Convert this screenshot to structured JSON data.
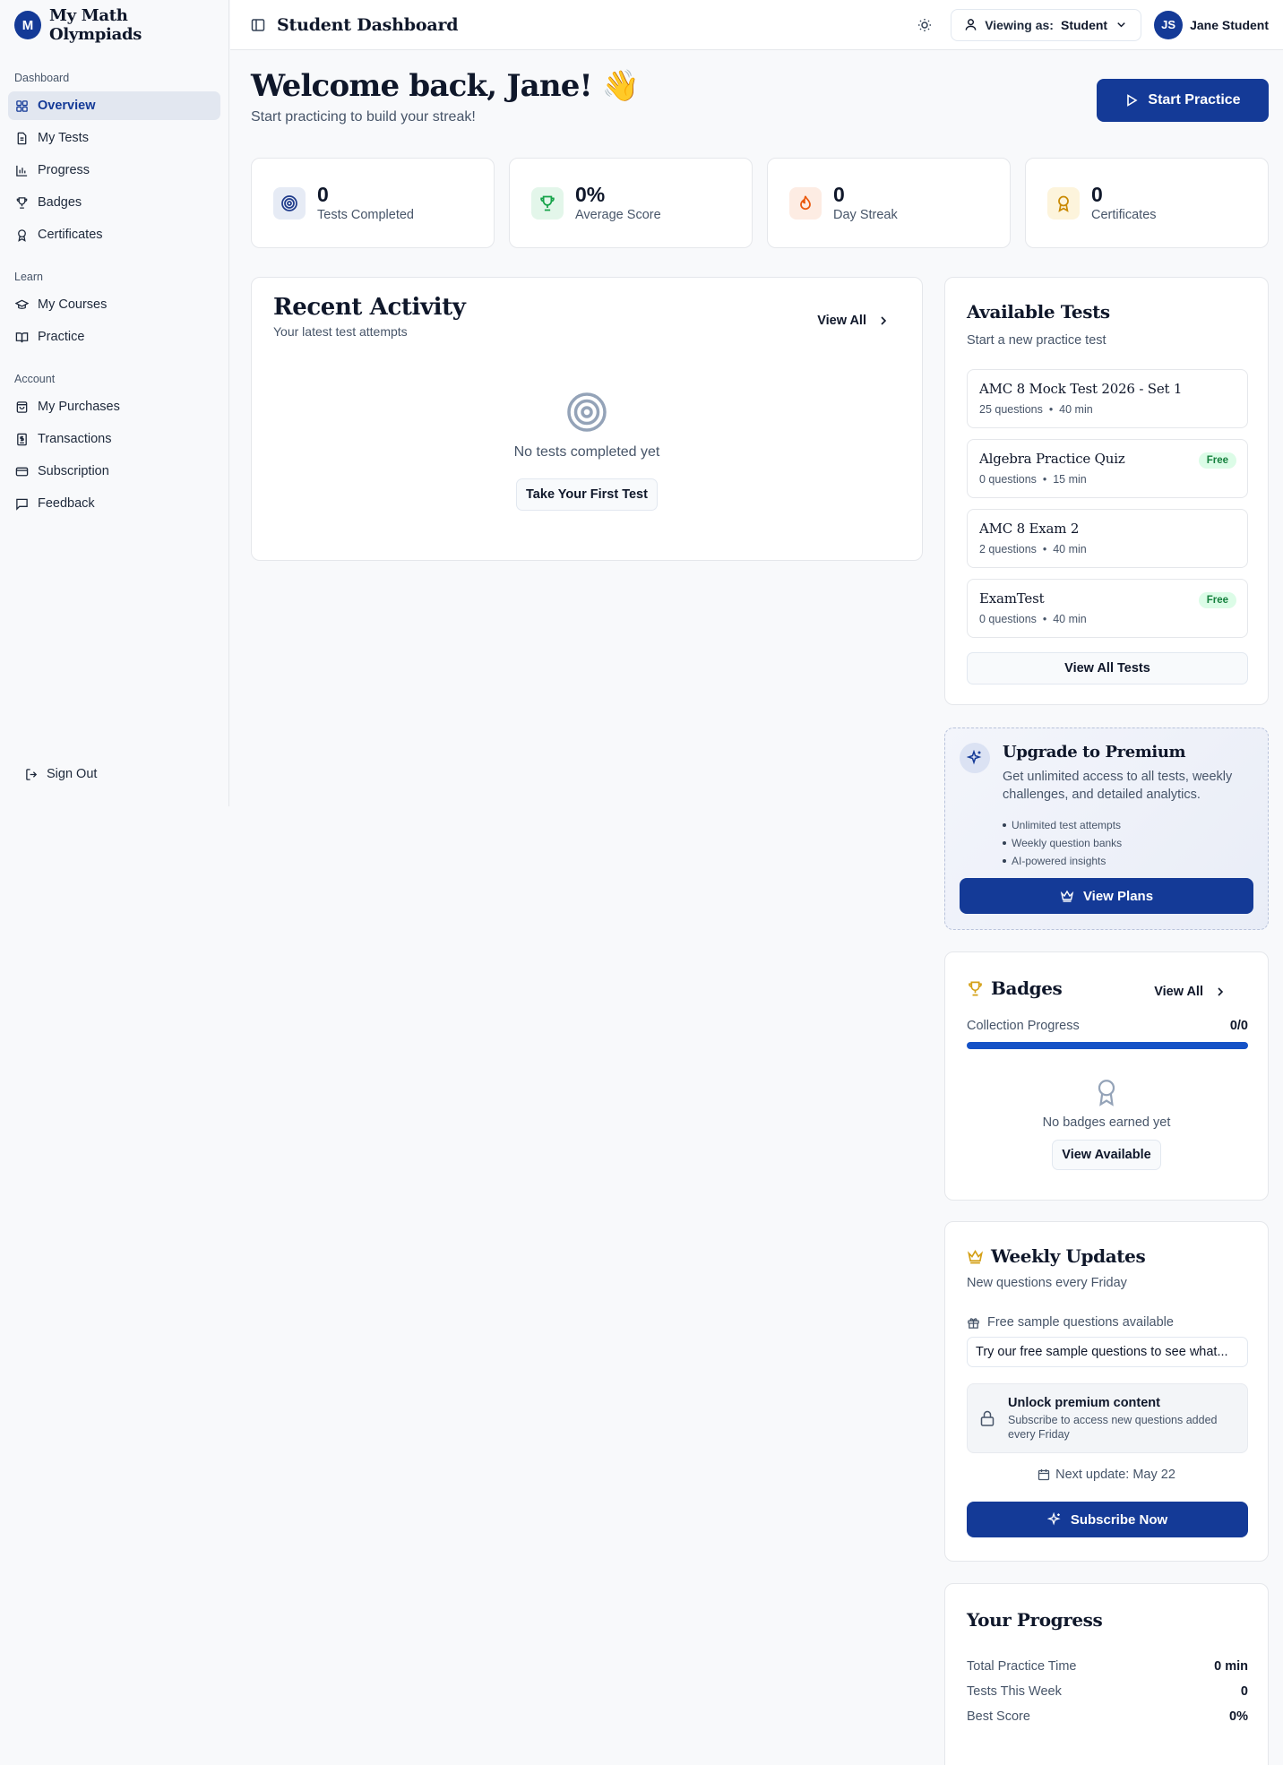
{
  "brand": {
    "logo_letter": "M",
    "name": "My Math Olympiads"
  },
  "sidebar": {
    "groups": [
      {
        "label": "Dashboard",
        "items": [
          {
            "label": "Overview",
            "icon": "grid-icon",
            "active": true
          },
          {
            "label": "My Tests",
            "icon": "file-text-icon"
          },
          {
            "label": "Progress",
            "icon": "bar-chart-icon"
          },
          {
            "label": "Badges",
            "icon": "trophy-icon"
          },
          {
            "label": "Certificates",
            "icon": "award-icon"
          }
        ]
      },
      {
        "label": "Learn",
        "items": [
          {
            "label": "My Courses",
            "icon": "graduation-cap-icon"
          },
          {
            "label": "Practice",
            "icon": "book-open-icon"
          }
        ]
      },
      {
        "label": "Account",
        "items": [
          {
            "label": "My Purchases",
            "icon": "shopping-bag-icon"
          },
          {
            "label": "Transactions",
            "icon": "receipt-icon"
          },
          {
            "label": "Subscription",
            "icon": "credit-card-icon"
          },
          {
            "label": "Feedback",
            "icon": "message-square-icon"
          }
        ]
      }
    ],
    "sign_out": "Sign Out"
  },
  "header": {
    "title": "Student Dashboard",
    "viewing_label": "Viewing as:",
    "viewing_value": "Student",
    "user_initials": "JS",
    "user_name": "Jane Student"
  },
  "welcome": {
    "title": "Welcome back, Jane! 👋",
    "subtitle": "Start practicing to build your streak!",
    "start_button": "Start Practice"
  },
  "stats": [
    {
      "value": "0",
      "label": "Tests Completed",
      "icon": "target-icon",
      "color": "#1e3a8a",
      "bg": "#e6ebf5"
    },
    {
      "value": "0%",
      "label": "Average Score",
      "icon": "trophy-icon",
      "color": "#16a34a",
      "bg": "#e3f6ea"
    },
    {
      "value": "0",
      "label": "Day Streak",
      "icon": "flame-icon",
      "color": "#ea580c",
      "bg": "#fdece3"
    },
    {
      "value": "0",
      "label": "Certificates",
      "icon": "award-icon",
      "color": "#ca8a04",
      "bg": "#fdf4dc"
    }
  ],
  "recent": {
    "title": "Recent Activity",
    "subtitle": "Your latest test attempts",
    "view_all": "View All",
    "empty_text": "No tests completed yet",
    "empty_button": "Take Your First Test"
  },
  "available": {
    "title": "Available Tests",
    "subtitle": "Start a new practice test",
    "tests": [
      {
        "name": "AMC 8 Mock Test 2026 - Set 1",
        "questions": "25 questions",
        "duration": "40 min",
        "badge": ""
      },
      {
        "name": "Algebra Practice Quiz",
        "questions": "0 questions",
        "duration": "15 min",
        "badge": "Free"
      },
      {
        "name": "AMC 8 Exam 2",
        "questions": "2 questions",
        "duration": "40 min",
        "badge": ""
      },
      {
        "name": "ExamTest",
        "questions": "0 questions",
        "duration": "40 min",
        "badge": "Free"
      }
    ],
    "view_all_button": "View All Tests"
  },
  "premium": {
    "title": "Upgrade to Premium",
    "description": "Get unlimited access to all tests, weekly challenges, and detailed analytics.",
    "features": [
      "Unlimited test attempts",
      "Weekly question banks",
      "AI-powered insights"
    ],
    "button": "View Plans"
  },
  "badges": {
    "title": "Badges",
    "view_all": "View All",
    "collection_label": "Collection Progress",
    "collection_value": "0/0",
    "progress_fraction": 1.0,
    "empty_text": "No badges earned yet",
    "empty_button": "View Available"
  },
  "weekly": {
    "title": "Weekly Updates",
    "subtitle": "New questions every Friday",
    "sample_label": "Free sample questions available",
    "sample_text": "Try our free sample questions to see what...",
    "unlock_title": "Unlock premium content",
    "unlock_desc": "Subscribe to access new questions added every Friday",
    "next_update": "Next update: May 22",
    "button": "Subscribe Now"
  },
  "your_progress": {
    "title": "Your Progress",
    "rows": [
      {
        "label": "Total Practice Time",
        "value": "0 min"
      },
      {
        "label": "Tests This Week",
        "value": "0"
      },
      {
        "label": "Best Score",
        "value": "0%"
      }
    ]
  }
}
